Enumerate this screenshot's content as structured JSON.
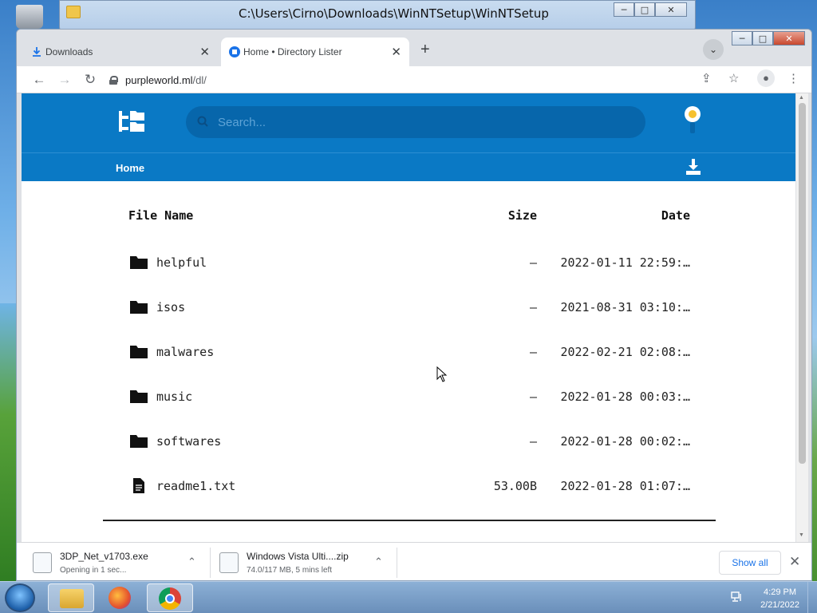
{
  "explorer": {
    "title": "C:\\Users\\Cirno\\Downloads\\WinNTSetup\\WinNTSetup",
    "minimize": "─",
    "maximize": "□",
    "close": "✕"
  },
  "chrome": {
    "tabs": [
      {
        "label": "Downloads",
        "close": "✕",
        "icon": "download-icon"
      },
      {
        "label": "Home • Directory Lister",
        "close": "✕",
        "icon": "directory-lister-favicon"
      }
    ],
    "new_tab": "+",
    "tab_search": "⌄",
    "window_controls": {
      "minimize": "─",
      "maximize": "□",
      "close": "✕"
    },
    "nav": {
      "back": "←",
      "forward": "→",
      "reload": "↻"
    },
    "url_domain": "purpleworld.ml",
    "url_path": "/dl/",
    "toolbar_icons": {
      "share": "⇪",
      "bookmark": "☆",
      "profile": "●",
      "menu": "⋮"
    }
  },
  "site": {
    "search_placeholder": "Search...",
    "breadcrumb": "Home",
    "accent": "#0a79c5"
  },
  "table": {
    "headers": {
      "name": "File Name",
      "size": "Size",
      "date": "Date"
    },
    "rows": [
      {
        "type": "folder",
        "name": "helpful",
        "size": "—",
        "date": "2022-01-11 22:59:…"
      },
      {
        "type": "folder",
        "name": "isos",
        "size": "—",
        "date": "2021-08-31 03:10:…"
      },
      {
        "type": "folder",
        "name": "malwares",
        "size": "—",
        "date": "2022-02-21 02:08:…"
      },
      {
        "type": "folder",
        "name": "music",
        "size": "—",
        "date": "2022-01-28 00:03:…"
      },
      {
        "type": "folder",
        "name": "softwares",
        "size": "—",
        "date": "2022-01-28 00:02:…"
      },
      {
        "type": "file",
        "name": "readme1.txt",
        "size": "53.00B",
        "date": "2022-01-28 01:07:…"
      }
    ]
  },
  "downloads": [
    {
      "name": "3DP_Net_v1703.exe",
      "status": "Opening in 1 sec...",
      "caret": "⌃"
    },
    {
      "name": "Windows Vista Ulti....zip",
      "status": "74.0/117 MB, 5 mins left",
      "caret": "⌃"
    }
  ],
  "shelf": {
    "show_all": "Show all",
    "close": "✕"
  },
  "taskbar": {
    "time": "4:29 PM",
    "date": "2/21/2022"
  }
}
